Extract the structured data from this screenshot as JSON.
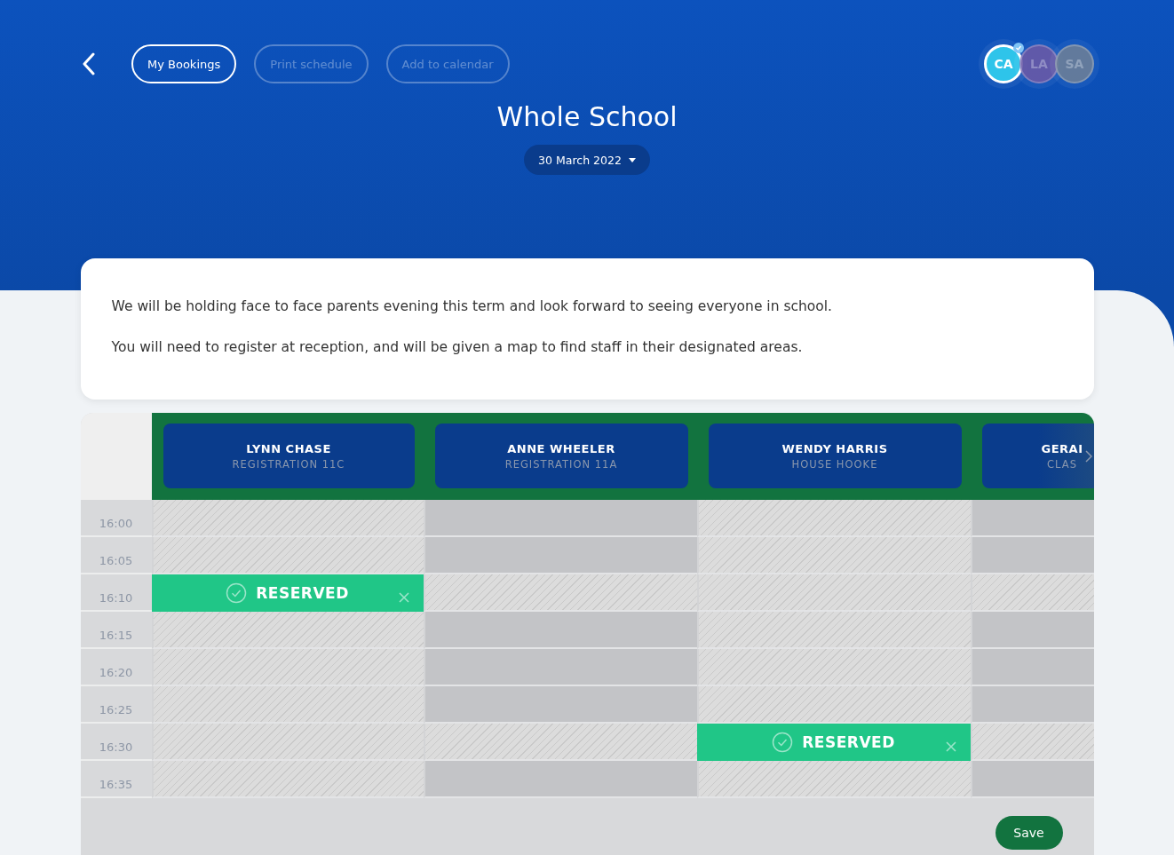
{
  "toolbar": {
    "buttons": [
      {
        "label": "My Bookings",
        "disabled": false
      },
      {
        "label": "Print schedule",
        "disabled": true
      },
      {
        "label": "Add to calendar",
        "disabled": true
      }
    ]
  },
  "avatars": [
    {
      "initials": "CA",
      "selected": true,
      "color": "#2ec4ea"
    },
    {
      "initials": "LA",
      "selected": false,
      "color": "#6a5aa8"
    },
    {
      "initials": "SA",
      "selected": false,
      "color": "#6c7f99"
    }
  ],
  "title": "Whole School",
  "date_picker": {
    "value": "30 March 2022"
  },
  "notice": {
    "paragraphs": [
      "We will be holding face to face parents evening this term and look forward to seeing everyone in school.",
      "You will need to register at reception, and will be given a map to find staff in their designated areas."
    ]
  },
  "schedule": {
    "times": [
      "16:00",
      "16:05",
      "16:10",
      "16:15",
      "16:20",
      "16:25",
      "16:30",
      "16:35"
    ],
    "staff": [
      {
        "name": "LYNN CHASE",
        "role": "REGISTRATION 11C",
        "slots": [
          {
            "kind": "unavailable"
          },
          {
            "kind": "unavailable"
          },
          {
            "kind": "reserved",
            "label": "RESERVED"
          },
          {
            "kind": "unavailable"
          },
          {
            "kind": "unavailable"
          },
          {
            "kind": "unavailable"
          },
          {
            "kind": "unavailable"
          },
          {
            "kind": "unavailable"
          }
        ]
      },
      {
        "name": "ANNE WHEELER",
        "role": "REGISTRATION 11A",
        "slots": [
          {
            "kind": "available"
          },
          {
            "kind": "available"
          },
          {
            "kind": "unavailable"
          },
          {
            "kind": "available"
          },
          {
            "kind": "available"
          },
          {
            "kind": "available"
          },
          {
            "kind": "unavailable"
          },
          {
            "kind": "available"
          }
        ]
      },
      {
        "name": "WENDY HARRIS",
        "role": "HOUSE HOOKE",
        "slots": [
          {
            "kind": "unavailable"
          },
          {
            "kind": "unavailable"
          },
          {
            "kind": "unavailable"
          },
          {
            "kind": "unavailable"
          },
          {
            "kind": "unavailable"
          },
          {
            "kind": "unavailable"
          },
          {
            "kind": "reserved",
            "label": "RESERVED"
          },
          {
            "kind": "unavailable"
          }
        ]
      },
      {
        "name": "GERAI",
        "role": "CLAS",
        "slots": [
          {
            "kind": "available"
          },
          {
            "kind": "available"
          },
          {
            "kind": "unavailable"
          },
          {
            "kind": "available"
          },
          {
            "kind": "available"
          },
          {
            "kind": "available"
          },
          {
            "kind": "unavailable"
          },
          {
            "kind": "available"
          }
        ]
      }
    ]
  },
  "save_button": {
    "label": "Save"
  }
}
